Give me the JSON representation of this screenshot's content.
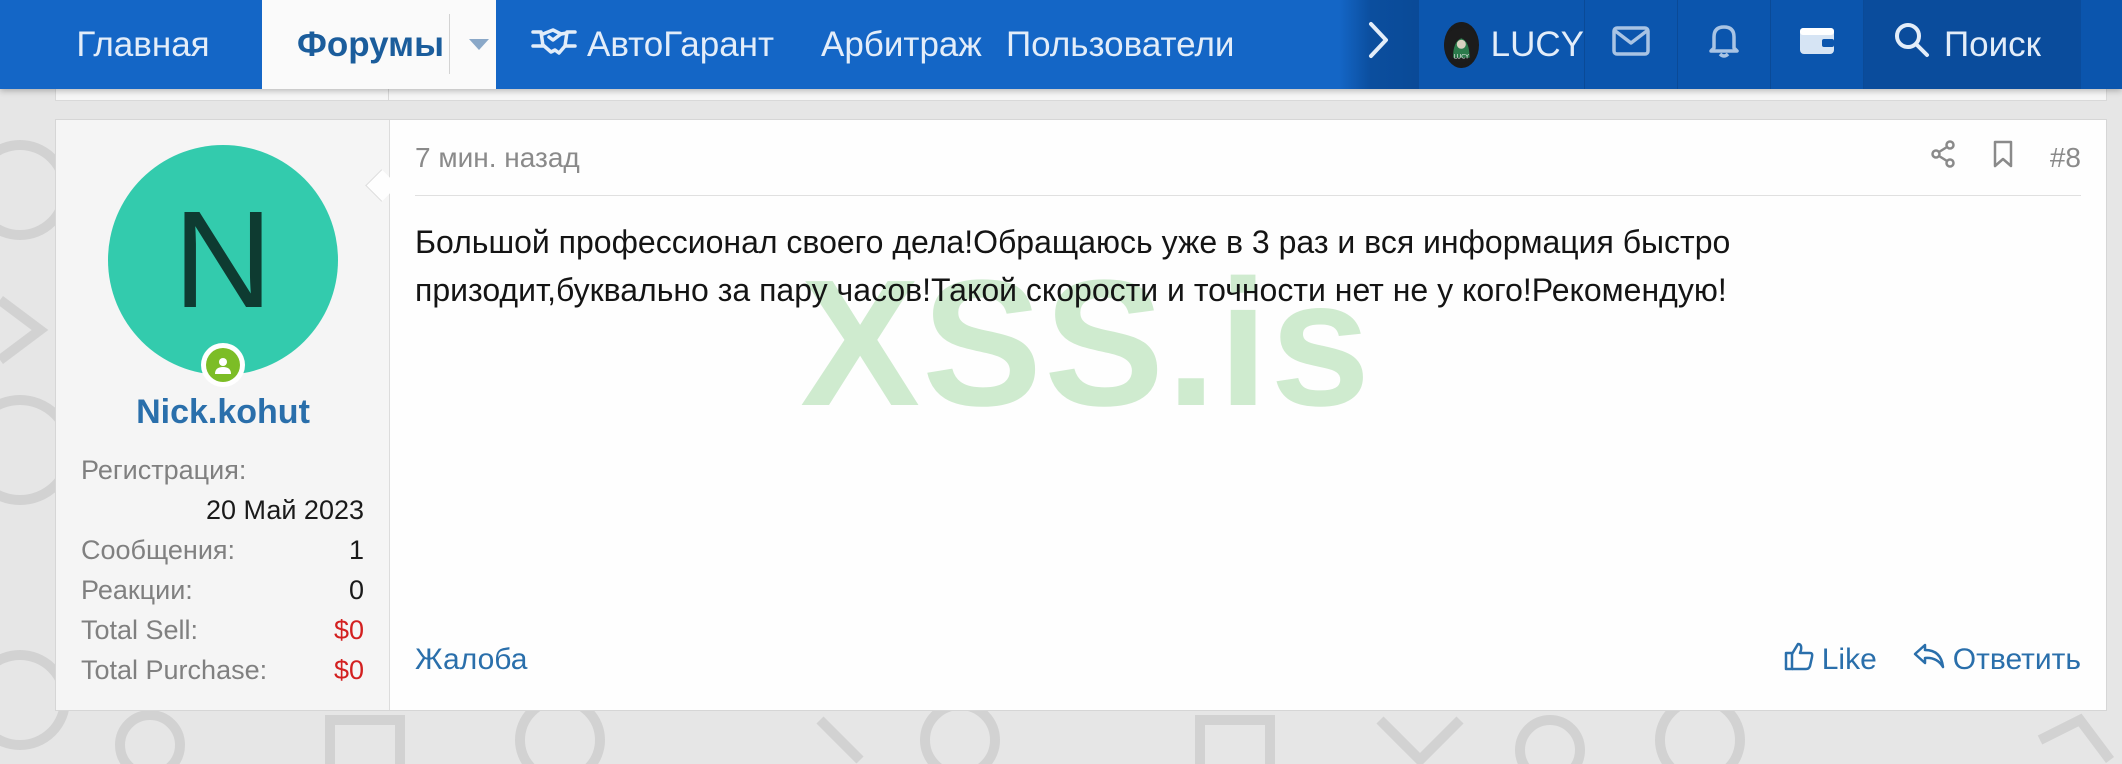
{
  "nav": {
    "home": "Главная",
    "forums": "Форумы",
    "autogarant": "АвтоГарант",
    "arbitrage": "Арбитраж",
    "users": "Пользователи",
    "username": "LUCY",
    "search": "Поиск"
  },
  "post": {
    "author": {
      "avatar_letter": "N",
      "name": "Nick.kohut",
      "registration_label": "Регистрация:",
      "registration_value": "20 Май 2023",
      "messages_label": "Сообщения:",
      "messages_value": "1",
      "reactions_label": "Реакции:",
      "reactions_value": "0",
      "total_sell_label": "Total Sell:",
      "total_sell_value": "$0",
      "total_purchase_label": "Total Purchase:",
      "total_purchase_value": "$0"
    },
    "time": "7 мин. назад",
    "number": "#8",
    "body": "Большой профессионал своего дела!Обращаюсь уже в 3 раз и вся информация быстро призодит,буквально за пару часов!Такой скорости и точности нет не у кого!Рекомендую!",
    "watermark": "XSS.is",
    "report": "Жалоба",
    "like": "Like",
    "reply": "Ответить"
  },
  "colors": {
    "navbar": "#1466c6",
    "avatar_bg": "#33cbad",
    "link": "#2a6fab",
    "money_red": "#d32020",
    "online": "#7cbd26"
  },
  "icons": [
    "handshake-icon",
    "chevron-right-icon",
    "envelope-icon",
    "bell-icon",
    "wallet-icon",
    "search-icon",
    "share-icon",
    "bookmark-icon",
    "thumbs-up-icon",
    "reply-icon",
    "user-online-icon",
    "caret-down-icon"
  ]
}
